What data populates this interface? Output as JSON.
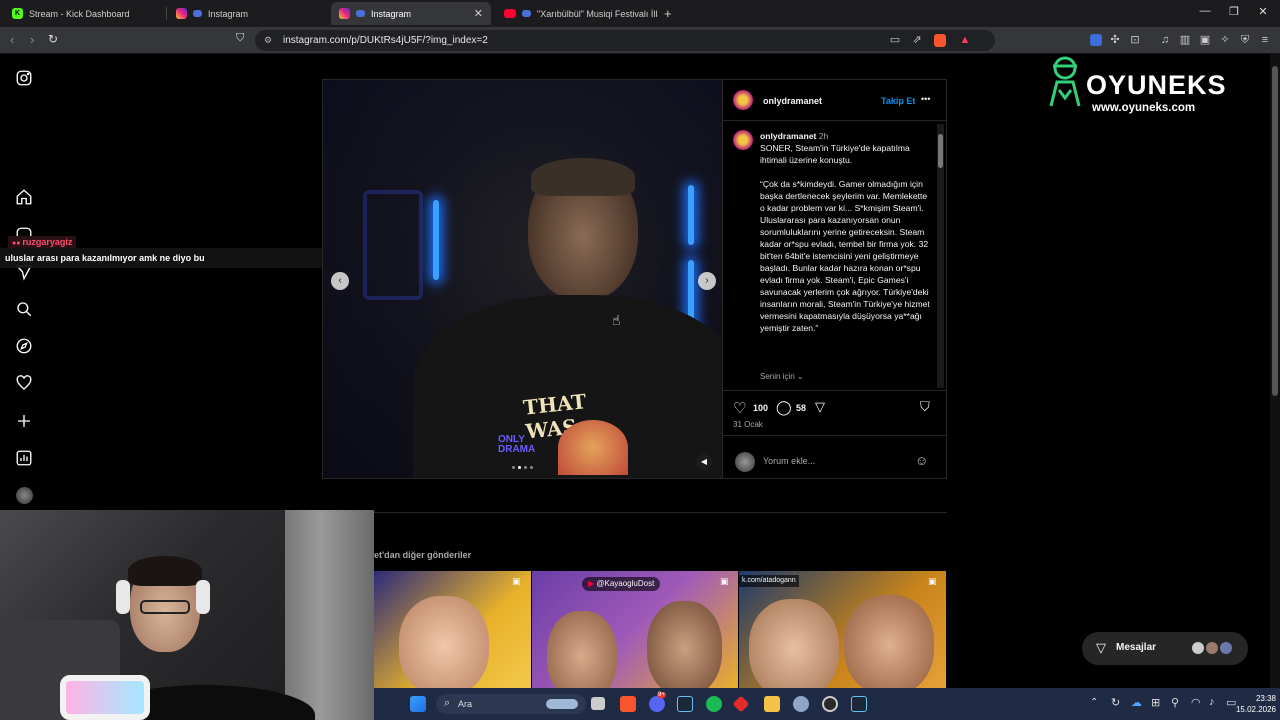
{
  "tabs": [
    {
      "label": "Stream - Kick Dashboard",
      "icon": "kick-icon",
      "color": "#53fc18"
    },
    {
      "label": "Instagram",
      "icon": "instagram-icon"
    },
    {
      "label": "Instagram",
      "icon": "instagram-icon",
      "active": true
    },
    {
      "label": "\"Xarıbülbül\" Musiqi Festivalı İllər Son",
      "icon": "youtube-icon"
    }
  ],
  "url": "instagram.com/p/DUKtRs4jU5F/?img_index=2",
  "chat": {
    "username": "ruzgaryagiz",
    "message": "uluslar arası para kazanılmıyor amk ne diyo bu"
  },
  "post": {
    "author": "onlydramanet",
    "follow": "Takip Et",
    "more": "•••",
    "caption_author": "onlydramanet",
    "caption_time": "2h",
    "caption_intro": "SONER, Steam'in Türkiye'de kapatılma ihtimali üzerine konuştu.",
    "caption_quote": "“Çok da s*kimdeydi. Gamer olmadığım için başka dertlenecek şeylerim var. Memlekette o kadar problem var ki... S*kmişim Steam'i. Uluslararası para kazanıyorsan onun sorumluluklarını yerine getireceksin. Steam kadar or*spu evladı, tembel bir firma yok. 32 bit'ten 64bit'e istemcisini yeni geliştirmeye başladı. Bunlar kadar hazıra konan or*spu evladı firma yok. Steam'i, Epic Games'i savunacak yerlerim çok ağrıyor. Türkiye'deki insanların morali, Steam'in Türkiye'ye hizmet vermesini kapatmasıyla düşüyorsa ya**ağı yemiştir zaten.”",
    "for_you": "Senin için",
    "likes": "100",
    "comments": "58",
    "date": "31 Ocak",
    "comment_placeholder": "Yorum ekle...",
    "shirt_text": "THAT WAS",
    "brand_overlay": "ONLY DRAMA"
  },
  "more_posts": {
    "label": "et'dan diğer gönderiler",
    "thumb2_tag": "@KayaogluDost",
    "thumb3_url": "k.com/atadogann"
  },
  "logo": {
    "name": "OYUNEKS",
    "url": "www.oyuneks.com",
    "color": "#34d17a"
  },
  "messages": {
    "label": "Mesajlar"
  },
  "taskbar": {
    "search": "Ara",
    "time": "23:38",
    "date": "15.02.2026",
    "discord_badge": "9+"
  }
}
